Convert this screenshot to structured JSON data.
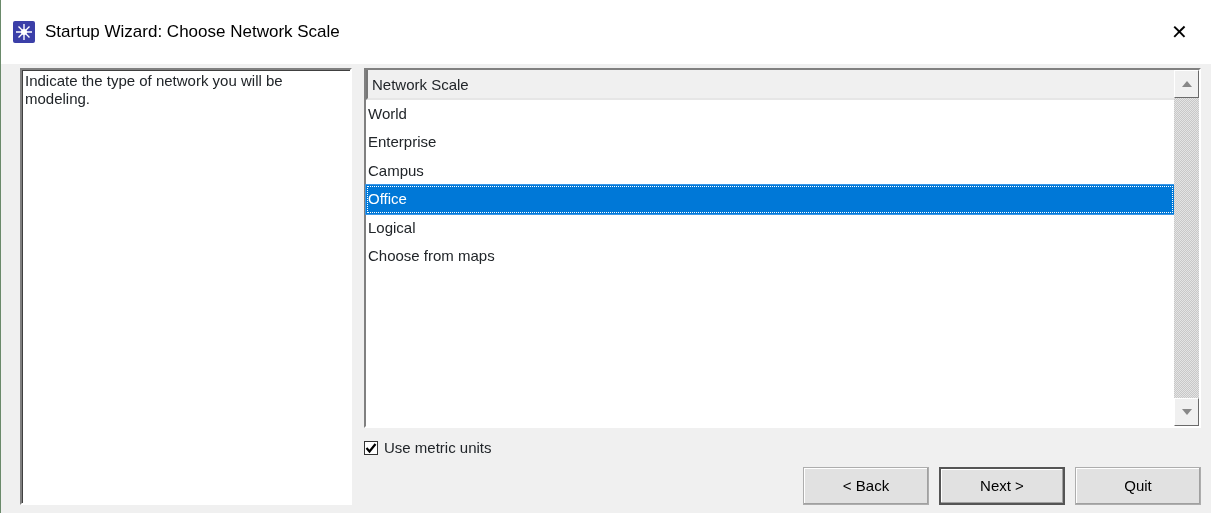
{
  "window": {
    "title": "Startup Wizard: Choose Network Scale",
    "close": "✕"
  },
  "description": "Indicate the type of network you will be modeling.",
  "list": {
    "header": "Network Scale",
    "items": [
      {
        "label": "World",
        "selected": false
      },
      {
        "label": "Enterprise",
        "selected": false
      },
      {
        "label": "Campus",
        "selected": false
      },
      {
        "label": "Office",
        "selected": true
      },
      {
        "label": "Logical",
        "selected": false
      },
      {
        "label": "Choose from maps",
        "selected": false
      }
    ]
  },
  "metric": {
    "label": "Use metric units",
    "checked": true
  },
  "buttons": [
    {
      "label": "< Back",
      "default": false
    },
    {
      "label": "Next >",
      "default": true
    },
    {
      "label": "Quit",
      "default": false
    }
  ]
}
